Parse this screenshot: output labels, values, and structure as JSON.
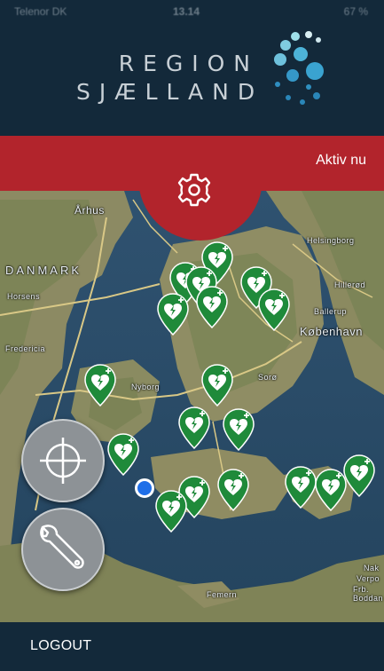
{
  "status_bar": {
    "carrier": "Telenor DK",
    "time": "13.14",
    "battery": "67 %"
  },
  "header": {
    "logo_line1": "REGION",
    "logo_line2": "SJÆLLAND"
  },
  "banner": {
    "status_label": "Aktiv nu"
  },
  "map": {
    "places": {
      "arhus": "Århus",
      "danmark": "DANMARK",
      "horsens": "Horsens",
      "fredericia": "Fredericia",
      "helsingborg": "Helsingborg",
      "hillerod": "Hillerød",
      "ballerup": "Ballerup",
      "kobenhavn": "København",
      "soro": "Sorø",
      "femern": "Femern",
      "nakskov": "Nak",
      "nyborg": "Nyborg",
      "fehmarn_b": "Verpo",
      "fehmarn_c": "Frb. Boddan"
    },
    "marker_icon": "aed-heart-icon"
  },
  "controls": {
    "locate_icon": "crosshair-icon",
    "tools_icon": "wrench-icon"
  },
  "footer": {
    "logout_label": "LOGOUT"
  },
  "colors": {
    "header_bg": "#13293a",
    "banner_red": "#b2242c",
    "marker_green": "#1f8a3a",
    "user_dot": "#1f6fe8"
  }
}
